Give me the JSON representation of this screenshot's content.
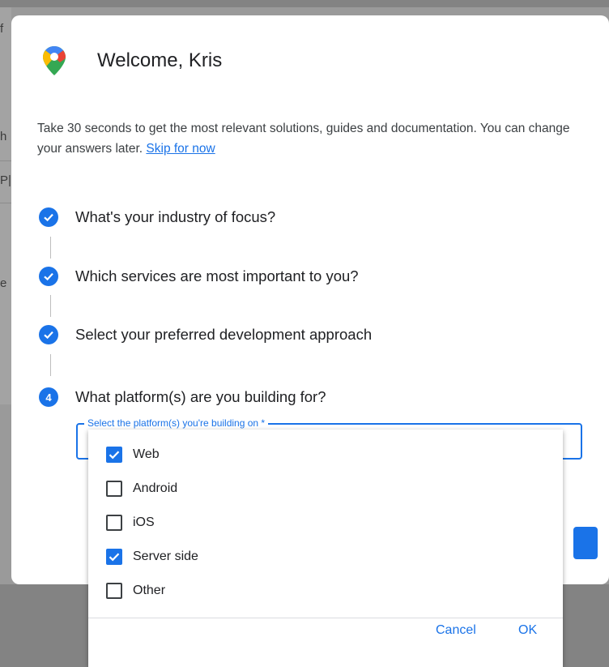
{
  "background": {
    "fragments": [
      "f",
      "h",
      "P|",
      "e"
    ]
  },
  "dialog": {
    "title": "Welcome, Kris",
    "intro_text": "Take 30 seconds to get the most relevant solutions, guides and documentation. You can change your answers later.",
    "skip_link": "Skip for now",
    "steps": [
      {
        "label": "What's your industry of focus?",
        "state": "done"
      },
      {
        "label": "Which services are most important to you?",
        "state": "done"
      },
      {
        "label": "Select your preferred development approach",
        "state": "done"
      },
      {
        "label": "What platform(s) are you building for?",
        "state": "current",
        "number": "4"
      }
    ],
    "platform_field": {
      "label": "Select the platform(s) you're building on *"
    }
  },
  "dropdown": {
    "options": [
      {
        "label": "Web",
        "checked": true
      },
      {
        "label": "Android",
        "checked": false
      },
      {
        "label": "iOS",
        "checked": false
      },
      {
        "label": "Server side",
        "checked": true
      },
      {
        "label": "Other",
        "checked": false
      }
    ],
    "cancel_label": "Cancel",
    "ok_label": "OK"
  },
  "colors": {
    "accent": "#1a73e8",
    "scrim": "#838383"
  },
  "icons": {
    "logo": "google-maps-pin-icon",
    "step_done": "check-circle-icon",
    "checkbox_checked": "check-icon"
  }
}
